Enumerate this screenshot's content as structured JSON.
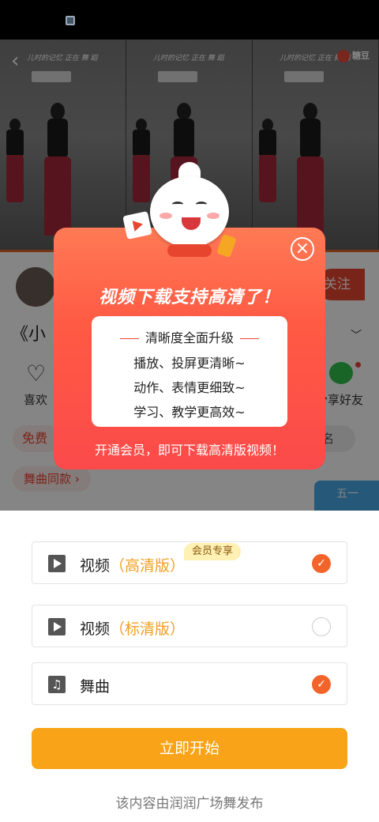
{
  "colors": {
    "accent": "#f2642a",
    "primary_button": "#f8a318",
    "popup_gradient_top": "#ff7a55",
    "popup_gradient_bottom": "#fb4a4a",
    "vip_tag": "#f0a020"
  },
  "video": {
    "caption": "儿时的记忆 正在 舞 蹈",
    "logo_text": "糖豆"
  },
  "page": {
    "follow_label": "关注",
    "title": "《小",
    "like_label": "喜欢",
    "share_label": "分享好友",
    "free_chip": "免费",
    "right_chip": "名",
    "dance_chip": "舞曲同款 ›",
    "ad_text": "五一"
  },
  "popup": {
    "heading": "视频下载支持高清了！",
    "card_title": "清晰度全面升级",
    "card_lines": [
      "播放、投屏更清晰~",
      "动作、表情更细致~",
      "学习、教学更高效~"
    ],
    "footer": "开通会员，即可下载高清版视频！",
    "close_icon": "×"
  },
  "sheet": {
    "options": [
      {
        "label": "视频",
        "tag": "（高清版）",
        "icon": "play-icon",
        "checked": true
      },
      {
        "label": "视频",
        "tag": "（标清版）",
        "icon": "play-icon",
        "checked": false
      },
      {
        "label": "舞曲",
        "tag": "",
        "icon": "music-note-icon",
        "checked": true
      }
    ],
    "vip_badge": "会员专享",
    "check_mark": "✓",
    "music_glyph": "♫",
    "start_label": "立即开始",
    "publisher": "该内容由润润广场舞发布"
  }
}
